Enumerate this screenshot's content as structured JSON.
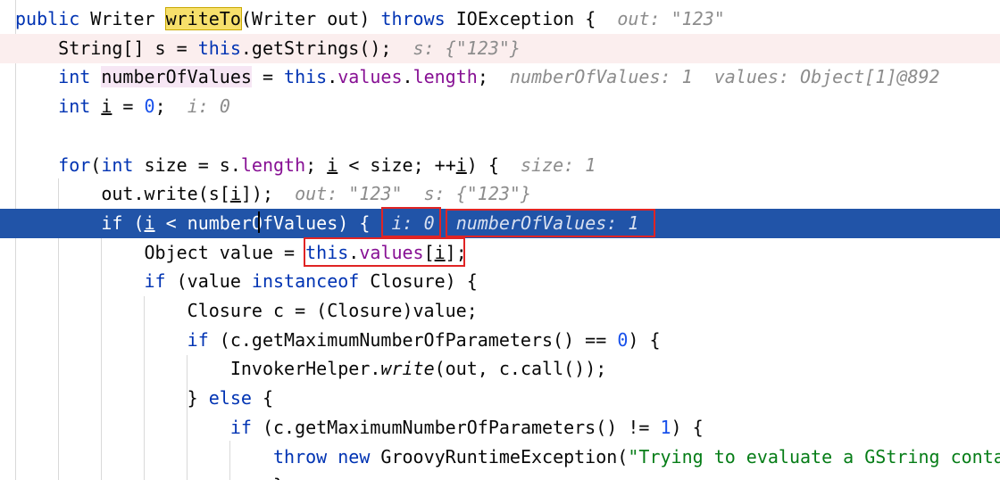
{
  "editor": {
    "lines": [
      {
        "segments": [
          {
            "t": "public ",
            "c": "kw"
          },
          {
            "t": "Writer ",
            "c": ""
          },
          {
            "t": "writeTo",
            "c": "search-hit"
          },
          {
            "t": "(Writer out) ",
            "c": ""
          },
          {
            "t": "throws ",
            "c": "kw"
          },
          {
            "t": "IOException {",
            "c": ""
          },
          {
            "t": "  out: ",
            "c": "hint"
          },
          {
            "t": "\"123\"",
            "c": "hint hstr"
          }
        ]
      },
      {
        "segments": [
          {
            "t": "    String[] s = ",
            "c": ""
          },
          {
            "t": "this",
            "c": "kw"
          },
          {
            "t": ".getStrings();",
            "c": ""
          },
          {
            "t": "  s: {\"123\"}",
            "c": "hint"
          }
        ]
      },
      {
        "segments": [
          {
            "t": "    ",
            "c": ""
          },
          {
            "t": "int ",
            "c": "kw"
          },
          {
            "t": "numberOfValues",
            "c": "var-hl"
          },
          {
            "t": " = ",
            "c": ""
          },
          {
            "t": "this",
            "c": "kw"
          },
          {
            "t": ".",
            "c": ""
          },
          {
            "t": "values",
            "c": "fld"
          },
          {
            "t": ".",
            "c": ""
          },
          {
            "t": "length",
            "c": "fld"
          },
          {
            "t": ";",
            "c": ""
          },
          {
            "t": "  numberOfValues: 1  values: Object[1]@892",
            "c": "hint"
          }
        ]
      },
      {
        "segments": [
          {
            "t": "    ",
            "c": ""
          },
          {
            "t": "int ",
            "c": "kw"
          },
          {
            "t": "i",
            "c": "ul"
          },
          {
            "t": " = ",
            "c": ""
          },
          {
            "t": "0",
            "c": "num"
          },
          {
            "t": ";",
            "c": ""
          },
          {
            "t": "  i: 0",
            "c": "hint"
          }
        ]
      },
      {
        "segments": []
      },
      {
        "segments": [
          {
            "t": "    ",
            "c": ""
          },
          {
            "t": "for",
            "c": "kw"
          },
          {
            "t": "(",
            "c": ""
          },
          {
            "t": "int ",
            "c": "kw"
          },
          {
            "t": "size = s.",
            "c": ""
          },
          {
            "t": "length",
            "c": "fld"
          },
          {
            "t": "; ",
            "c": ""
          },
          {
            "t": "i",
            "c": "ul"
          },
          {
            "t": " < size; ++",
            "c": ""
          },
          {
            "t": "i",
            "c": "ul"
          },
          {
            "t": ") {",
            "c": ""
          },
          {
            "t": "  size: 1",
            "c": "hint"
          }
        ]
      },
      {
        "segments": [
          {
            "t": "        out.write(s[",
            "c": ""
          },
          {
            "t": "i",
            "c": "ul"
          },
          {
            "t": "]);",
            "c": ""
          },
          {
            "t": "  out: ",
            "c": "hint"
          },
          {
            "t": "\"123\"",
            "c": "hint hstr"
          },
          {
            "t": "  s: {\"123\"}",
            "c": "hint"
          }
        ]
      },
      {
        "segments": [
          {
            "t": "        ",
            "c": ""
          },
          {
            "t": "if ",
            "c": "kw"
          },
          {
            "t": "(",
            "c": ""
          },
          {
            "t": "i",
            "c": "ul"
          },
          {
            "t": " < numberOfValues) {",
            "c": ""
          },
          {
            "t": "  i: 0",
            "c": "hint"
          },
          {
            "t": "  numberOfValues: 1",
            "c": "hint"
          }
        ]
      },
      {
        "segments": [
          {
            "t": "            Object value = ",
            "c": ""
          },
          {
            "t": "this",
            "c": "kw"
          },
          {
            "t": ".",
            "c": ""
          },
          {
            "t": "values",
            "c": "fld"
          },
          {
            "t": "[",
            "c": ""
          },
          {
            "t": "i",
            "c": "ul"
          },
          {
            "t": "];",
            "c": ""
          }
        ]
      },
      {
        "segments": [
          {
            "t": "            ",
            "c": ""
          },
          {
            "t": "if ",
            "c": "kw"
          },
          {
            "t": "(value ",
            "c": ""
          },
          {
            "t": "instanceof ",
            "c": "kw"
          },
          {
            "t": "Closure) {",
            "c": ""
          }
        ]
      },
      {
        "segments": [
          {
            "t": "                Closure c = (Closure)value;",
            "c": ""
          }
        ]
      },
      {
        "segments": [
          {
            "t": "                ",
            "c": ""
          },
          {
            "t": "if ",
            "c": "kw"
          },
          {
            "t": "(c.getMaximumNumberOfParameters() == ",
            "c": ""
          },
          {
            "t": "0",
            "c": "num"
          },
          {
            "t": ") {",
            "c": ""
          }
        ]
      },
      {
        "segments": [
          {
            "t": "                    InvokerHelper.",
            "c": ""
          },
          {
            "t": "write",
            "c": "it"
          },
          {
            "t": "(out, c.call());",
            "c": ""
          }
        ]
      },
      {
        "segments": [
          {
            "t": "                } ",
            "c": ""
          },
          {
            "t": "else ",
            "c": "kw"
          },
          {
            "t": "{",
            "c": ""
          }
        ]
      },
      {
        "segments": [
          {
            "t": "                    ",
            "c": ""
          },
          {
            "t": "if ",
            "c": "kw"
          },
          {
            "t": "(c.getMaximumNumberOfParameters() != ",
            "c": ""
          },
          {
            "t": "1",
            "c": "num"
          },
          {
            "t": ") {",
            "c": ""
          }
        ]
      },
      {
        "segments": [
          {
            "t": "                        ",
            "c": ""
          },
          {
            "t": "throw new ",
            "c": "kw"
          },
          {
            "t": "GroovyRuntimeException(",
            "c": ""
          },
          {
            "t": "\"Trying to evaluate a GString conta",
            "c": "str"
          }
        ]
      },
      {
        "segments": [
          {
            "t": "                        }",
            "c": ""
          }
        ]
      }
    ],
    "line_styles": [
      "",
      "hl-pink",
      "",
      "",
      "",
      "",
      "",
      "hl-exec",
      "",
      "",
      "",
      "",
      "",
      "",
      "",
      "",
      ""
    ]
  }
}
